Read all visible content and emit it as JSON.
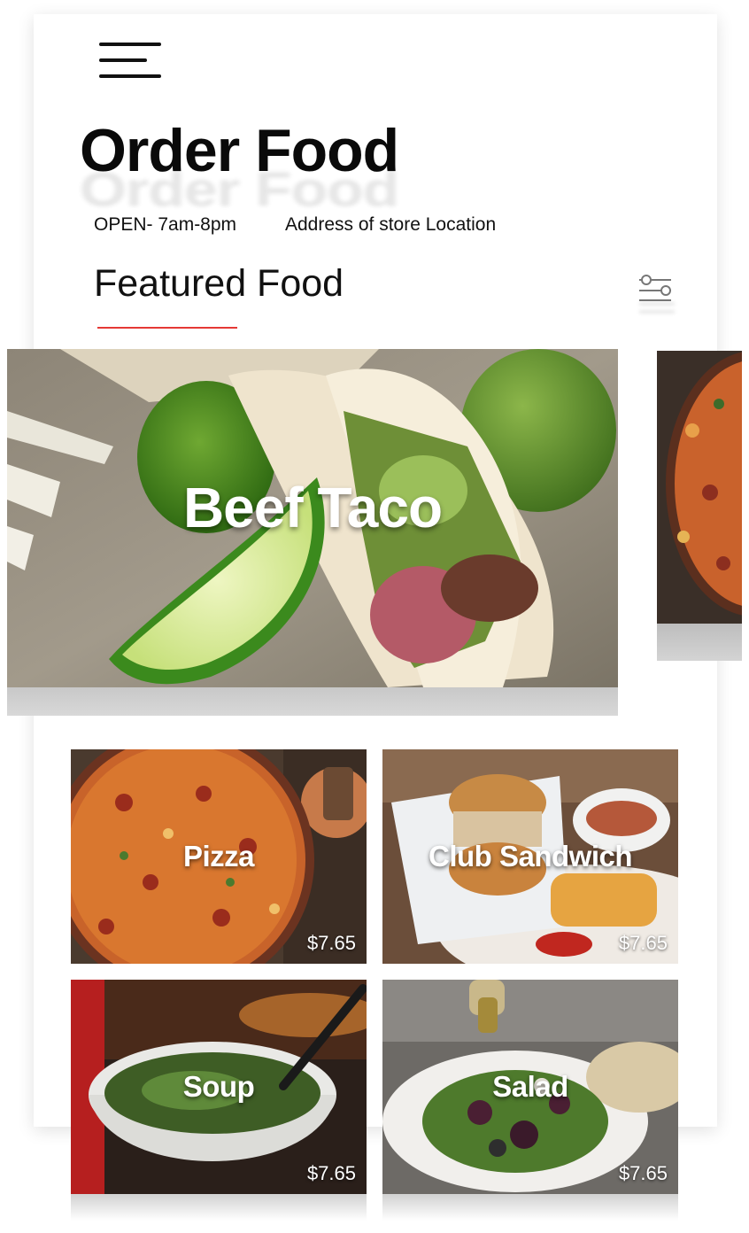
{
  "header": {
    "title": "Order Food",
    "hours": "OPEN- 7am-8pm",
    "address": "Address of store Location",
    "menu_icon": "hamburger-menu-icon",
    "filter_icon": "filter-sliders-icon"
  },
  "featured": {
    "section_title": "Featured Food",
    "items": [
      {
        "label": "Beef Taco"
      }
    ],
    "accent": "#e53935"
  },
  "menu": {
    "items": [
      {
        "name": "Pizza",
        "price": "$7.65"
      },
      {
        "name": "Club Sandwich",
        "price": "$7.65"
      },
      {
        "name": "Soup",
        "price": "$7.65"
      },
      {
        "name": "Salad",
        "price": "$7.65"
      }
    ]
  }
}
